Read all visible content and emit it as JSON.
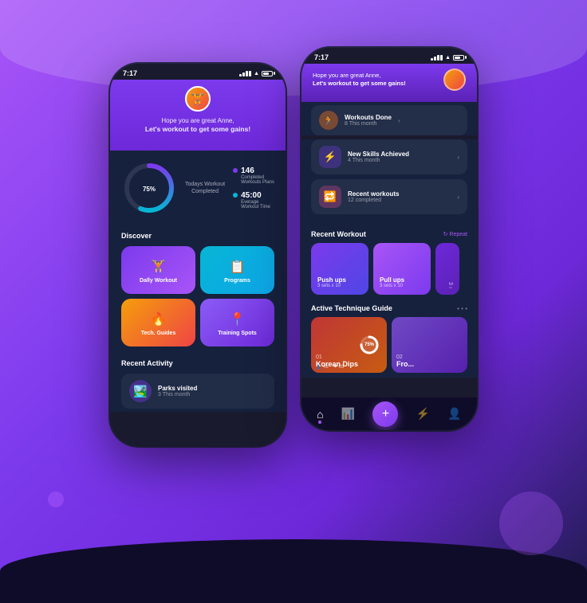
{
  "background": {
    "gradient_start": "#a855f7",
    "gradient_end": "#1e1b4b"
  },
  "phone1": {
    "status_bar": {
      "time": "7:17"
    },
    "header": {
      "greeting_line1": "Hope you are great Anne,",
      "greeting_line2": "Let's workout to get some gains!"
    },
    "stats": {
      "progress_percent": "75",
      "progress_label": "Todays Workout\nCompleted",
      "completed_count": "146",
      "completed_label": "Completed\nWorkouts Plans",
      "average_time": "45:00",
      "average_label": "Everage\nWorkout Time"
    },
    "discover": {
      "title": "Discover",
      "cards": [
        {
          "id": "daily",
          "label": "Dally Workout",
          "icon": "🏋️"
        },
        {
          "id": "programs",
          "label": "Programs",
          "icon": "📋"
        },
        {
          "id": "tech",
          "label": "Tech. Guides",
          "icon": "🔥"
        },
        {
          "id": "training",
          "label": "Training Spots",
          "icon": "📍"
        }
      ]
    },
    "recent_activity": {
      "title": "Recent Activity",
      "items": [
        {
          "id": "parks",
          "icon": "🏞️",
          "title": "Parks visited",
          "sub": "3 This month"
        }
      ]
    }
  },
  "phone2": {
    "status_bar": {
      "time": "7:17"
    },
    "header": {
      "greeting_line1": "Hope you are great Anne,",
      "greeting_line2": "Let's workout to get some gains!"
    },
    "activity_cards": [
      {
        "id": "workouts-done",
        "icon": "🏃",
        "color": "orange",
        "title": "Workouts Done",
        "sub": "8 This month"
      },
      {
        "id": "new-skills",
        "icon": "⚡",
        "color": "purple",
        "title": "New Skills Achieved",
        "sub": "4 This month"
      },
      {
        "id": "recent-workouts",
        "icon": "🔁",
        "color": "pink",
        "title": "Recent workouts",
        "sub": "12 completed"
      }
    ],
    "recent_workout": {
      "title": "Recent Workout",
      "action": "↻ Repeat",
      "cards": [
        {
          "id": "pushups",
          "title": "Push ups",
          "sub": "3 sets x 10",
          "style": "pushups"
        },
        {
          "id": "pullups",
          "title": "Pull ups",
          "sub": "3 sets x 10",
          "style": "pullups"
        }
      ]
    },
    "technique": {
      "title": "Active Technique Guide",
      "dots": "• • •",
      "cards": [
        {
          "id": "korean-dips",
          "num": "01",
          "title": "Korean Dips",
          "progress": "75%",
          "likes": "43",
          "heart": "65",
          "style": "tc-korean"
        },
        {
          "id": "front",
          "num": "02",
          "title": "Fro...",
          "style": "tc-front"
        }
      ]
    },
    "nav": {
      "items": [
        {
          "id": "home",
          "icon": "⌂",
          "active": true
        },
        {
          "id": "stats",
          "icon": "📊",
          "active": false
        },
        {
          "id": "add",
          "icon": "+",
          "is_center": true
        },
        {
          "id": "activity",
          "icon": "⚡",
          "active": false
        },
        {
          "id": "profile",
          "icon": "👤",
          "active": false
        }
      ]
    }
  }
}
